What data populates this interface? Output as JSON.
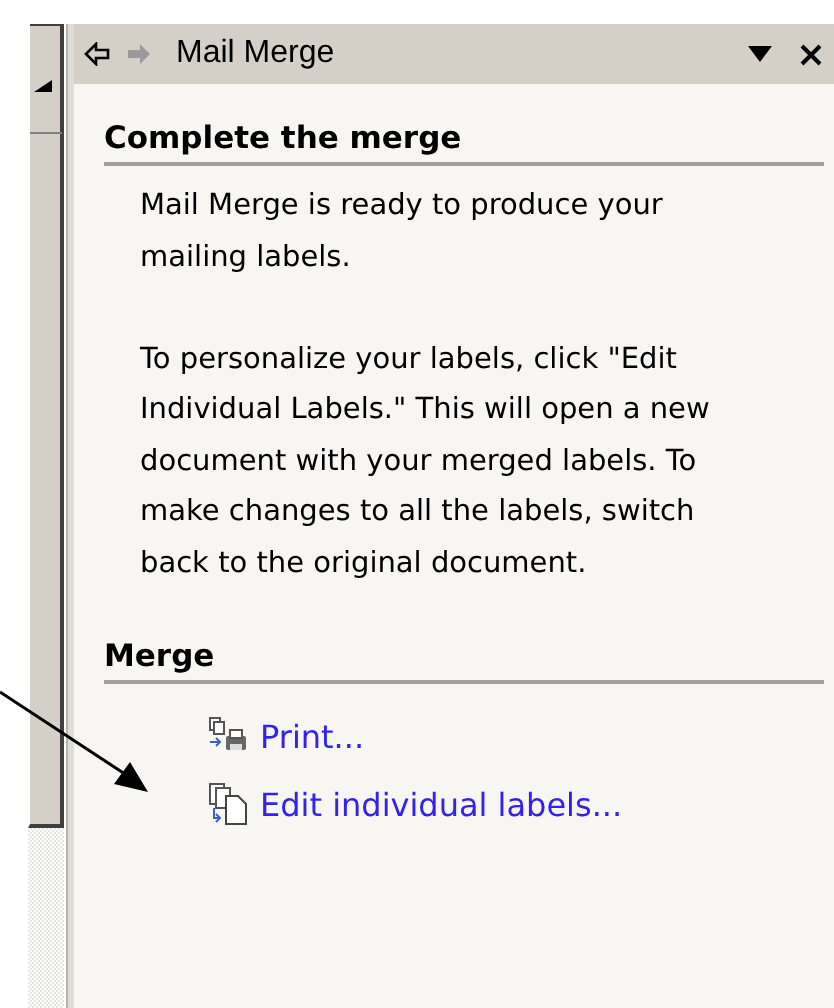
{
  "task_pane": {
    "title": "Mail Merge",
    "sections": [
      {
        "heading": "Complete the merge",
        "paragraphs": [
          "Mail Merge is ready to produce your mailing labels.",
          "To personalize your labels, click \"Edit Individual Labels.\" This will open a new document with your merged labels. To make changes to all the labels, switch back to the original document."
        ]
      },
      {
        "heading": "Merge",
        "links": [
          {
            "kind": "print",
            "label": "Print..."
          },
          {
            "kind": "edit",
            "label": "Edit individual labels..."
          }
        ]
      }
    ]
  }
}
